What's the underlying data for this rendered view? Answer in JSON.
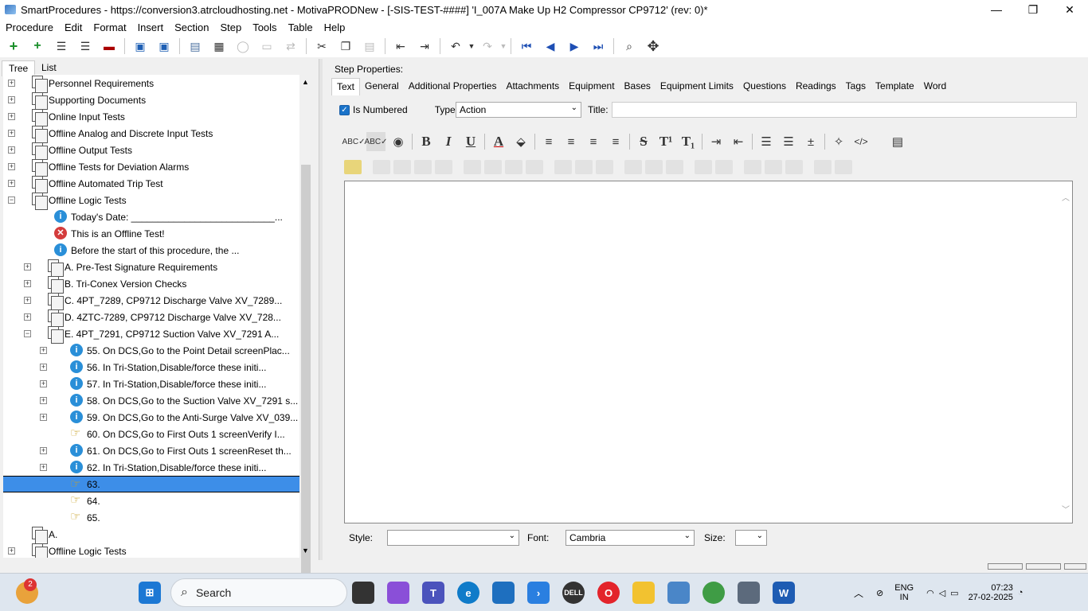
{
  "window": {
    "title": "SmartProcedures - https://conversion3.atrcloudhosting.net - MotivaPRODNew - [-SIS-TEST-####] 'I_007A Make Up H2 Compressor CP9712' (rev: 0)*",
    "controls": [
      "—",
      "❐",
      "✕"
    ]
  },
  "menu": [
    "Procedure",
    "Edit",
    "Format",
    "Insert",
    "Section",
    "Step",
    "Tools",
    "Table",
    "Help"
  ],
  "left_tabs": [
    "Tree",
    "List"
  ],
  "tree": [
    {
      "label": "Personnel Requirements",
      "icon": "doc",
      "exp": "+",
      "level": 0
    },
    {
      "label": "Supporting Documents",
      "icon": "doc",
      "exp": "+",
      "level": 0
    },
    {
      "label": "Online Input Tests",
      "icon": "doc",
      "exp": "+",
      "level": 0
    },
    {
      "label": "Offline Analog and Discrete Input Tests",
      "icon": "doc",
      "exp": "+",
      "level": 0
    },
    {
      "label": "Offline Output Tests",
      "icon": "doc",
      "exp": "+",
      "level": 0
    },
    {
      "label": "Offline Tests for Deviation Alarms",
      "icon": "doc",
      "exp": "+",
      "level": 0
    },
    {
      "label": "Offline Automated Trip Test",
      "icon": "doc",
      "exp": "+",
      "level": 0
    },
    {
      "label": "Offline Logic Tests",
      "icon": "doc",
      "exp": "−",
      "level": 0
    },
    {
      "label": "Today's Date: ___________________________...",
      "icon": "info",
      "exp": "",
      "level": 1
    },
    {
      "label": "This is an Offline Test!",
      "icon": "err",
      "exp": "",
      "level": 1
    },
    {
      "label": "Before the start of this procedure, the ...",
      "icon": "info",
      "exp": "",
      "level": 1
    },
    {
      "label": "A. Pre-Test Signature Requirements",
      "icon": "doc",
      "exp": "+",
      "level": 1
    },
    {
      "label": "B. Tri-Conex Version Checks",
      "icon": "doc",
      "exp": "+",
      "level": 1
    },
    {
      "label": "C. 4PT_7289, CP9712 Discharge Valve XV_7289...",
      "icon": "doc",
      "exp": "+",
      "level": 1
    },
    {
      "label": "D. 4ZTC-7289, CP9712 Discharge Valve XV_728...",
      "icon": "doc",
      "exp": "+",
      "level": 1
    },
    {
      "label": "E. 4PT_7291, CP9712 Suction Valve XV_7291 A...",
      "icon": "doc",
      "exp": "−",
      "level": 1
    },
    {
      "label": "55. On DCS,Go to the Point Detail screenPlac...",
      "icon": "info",
      "exp": "+",
      "level": 2
    },
    {
      "label": "56. In Tri-Station,Disable/force these initi...",
      "icon": "info",
      "exp": "+",
      "level": 2
    },
    {
      "label": "57. In Tri-Station,Disable/force these initi...",
      "icon": "info",
      "exp": "+",
      "level": 2
    },
    {
      "label": "58. On DCS,Go to the Suction Valve XV_7291 s...",
      "icon": "info",
      "exp": "+",
      "level": 2
    },
    {
      "label": "59. On DCS,Go to the Anti-Surge Valve XV_039...",
      "icon": "info",
      "exp": "+",
      "level": 2
    },
    {
      "label": "60. On DCS,Go to First Outs 1 screenVerify I...",
      "icon": "hand",
      "exp": "",
      "level": 2
    },
    {
      "label": "61. On DCS,Go to First Outs 1 screenReset th...",
      "icon": "info",
      "exp": "+",
      "level": 2
    },
    {
      "label": "62. In Tri-Station,Disable/force these initi...",
      "icon": "info",
      "exp": "+",
      "level": 2
    },
    {
      "label": "63.",
      "icon": "hand",
      "exp": "",
      "level": 2,
      "selected": true
    },
    {
      "label": "64.",
      "icon": "hand",
      "exp": "",
      "level": 2
    },
    {
      "label": "65.",
      "icon": "hand",
      "exp": "",
      "level": 2
    },
    {
      "label": "A.",
      "icon": "doc",
      "exp": "",
      "level": 0
    },
    {
      "label": "Offline Logic Tests",
      "icon": "doc",
      "exp": "+",
      "level": 0
    }
  ],
  "step_props": {
    "heading": "Step Properties:",
    "tabs": [
      "Text",
      "General",
      "Additional Properties",
      "Attachments",
      "Equipment",
      "Bases",
      "Equipment Limits",
      "Questions",
      "Readings",
      "Tags",
      "Template",
      "Word"
    ],
    "is_numbered_label": "Is Numbered",
    "type_label": "Type:",
    "type_value": "Action",
    "title_label": "Title:",
    "style_label": "Style:",
    "font_label": "Font:",
    "font_value": "Cambria",
    "size_label": "Size:"
  },
  "taskbar": {
    "search": "Search",
    "notif_count": "2",
    "lang": "ENG",
    "region": "IN",
    "time": "07:23",
    "date": "27-02-2025"
  }
}
